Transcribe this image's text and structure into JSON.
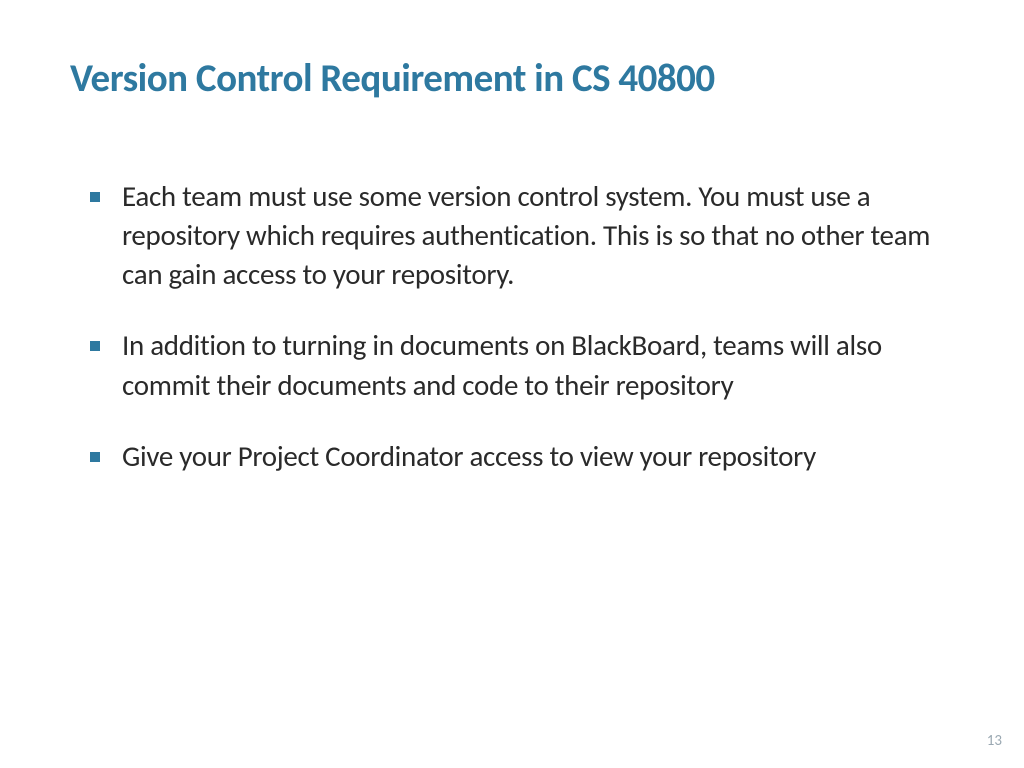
{
  "title": "Version Control Requirement in CS 40800",
  "bullets": [
    "Each team must use some version control system. You must use a repository which requires authentication. This is so that no other team can gain access to your repository.",
    "In addition to turning in documents on BlackBoard, teams will also commit their documents and code to their repository",
    "Give your Project Coordinator access to view your repository"
  ],
  "page_number": "13"
}
